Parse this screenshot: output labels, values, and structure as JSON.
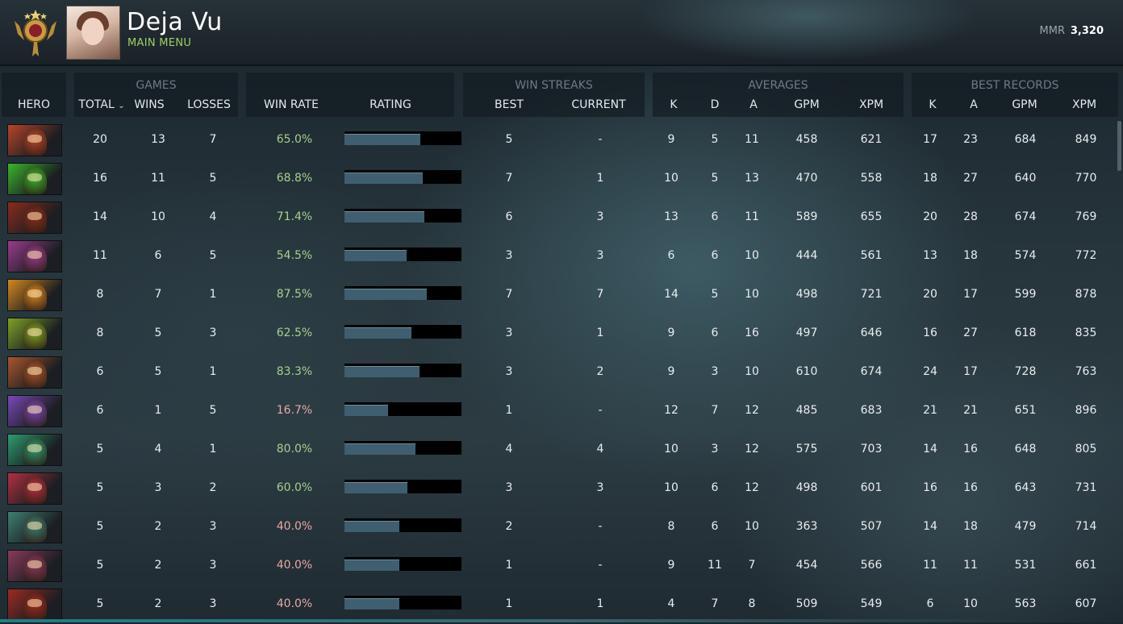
{
  "header": {
    "player_name": "Deja Vu",
    "subtitle": "MAIN MENU",
    "mmr_label": "MMR",
    "mmr_value": "3,320",
    "medal_icon": "immortal-rank-medal",
    "avatar_icon": "player-avatar"
  },
  "groups": {
    "games": "GAMES",
    "win_streaks": "WIN STREAKS",
    "averages": "AVERAGES",
    "best_records": "BEST RECORDS"
  },
  "columns": {
    "hero": "HERO",
    "total": "TOTAL",
    "wins": "WINS",
    "losses": "LOSSES",
    "win_rate": "WIN RATE",
    "rating": "RATING",
    "best": "BEST",
    "current": "CURRENT",
    "avg_k": "K",
    "avg_d": "D",
    "avg_a": "A",
    "avg_gpm": "GPM",
    "avg_xpm": "XPM",
    "best_k": "K",
    "best_a": "A",
    "best_gpm": "GPM",
    "best_xpm": "XPM"
  },
  "colors": {
    "win_rate_good": "#a6d08e",
    "win_rate_bad": "#e8a7a5",
    "rating_fill": "#3f5f70"
  },
  "rows": [
    {
      "hero_icon": "hero-portrait-1",
      "hero_color": "#b8452a",
      "total": "20",
      "wins": "13",
      "losses": "7",
      "win_rate": "65.0%",
      "rating": 0.65,
      "best": "5",
      "current": "-",
      "k": "9",
      "d": "5",
      "a": "11",
      "gpm": "458",
      "xpm": "621",
      "bk": "17",
      "ba": "23",
      "bgpm": "684",
      "bxpm": "849"
    },
    {
      "hero_icon": "hero-portrait-2",
      "hero_color": "#3bb52c",
      "total": "16",
      "wins": "11",
      "losses": "5",
      "win_rate": "68.8%",
      "rating": 0.67,
      "best": "7",
      "current": "1",
      "k": "10",
      "d": "5",
      "a": "13",
      "gpm": "470",
      "xpm": "558",
      "bk": "18",
      "ba": "27",
      "bgpm": "640",
      "bxpm": "770"
    },
    {
      "hero_icon": "hero-portrait-3",
      "hero_color": "#8a2c1d",
      "total": "14",
      "wins": "10",
      "losses": "4",
      "win_rate": "71.4%",
      "rating": 0.68,
      "best": "6",
      "current": "3",
      "k": "13",
      "d": "6",
      "a": "11",
      "gpm": "589",
      "xpm": "655",
      "bk": "20",
      "ba": "28",
      "bgpm": "674",
      "bxpm": "769"
    },
    {
      "hero_icon": "hero-portrait-4",
      "hero_color": "#9a3c8e",
      "total": "11",
      "wins": "6",
      "losses": "5",
      "win_rate": "54.5%",
      "rating": 0.53,
      "best": "3",
      "current": "3",
      "k": "6",
      "d": "6",
      "a": "10",
      "gpm": "444",
      "xpm": "561",
      "bk": "13",
      "ba": "18",
      "bgpm": "574",
      "bxpm": "772"
    },
    {
      "hero_icon": "hero-portrait-5",
      "hero_color": "#d6871f",
      "total": "8",
      "wins": "7",
      "losses": "1",
      "win_rate": "87.5%",
      "rating": 0.7,
      "best": "7",
      "current": "7",
      "k": "14",
      "d": "5",
      "a": "10",
      "gpm": "498",
      "xpm": "721",
      "bk": "20",
      "ba": "17",
      "bgpm": "599",
      "bxpm": "878"
    },
    {
      "hero_icon": "hero-portrait-6",
      "hero_color": "#7fa325",
      "total": "8",
      "wins": "5",
      "losses": "3",
      "win_rate": "62.5%",
      "rating": 0.57,
      "best": "3",
      "current": "1",
      "k": "9",
      "d": "6",
      "a": "16",
      "gpm": "497",
      "xpm": "646",
      "bk": "16",
      "ba": "27",
      "bgpm": "618",
      "bxpm": "835"
    },
    {
      "hero_icon": "hero-portrait-7",
      "hero_color": "#a8562d",
      "total": "6",
      "wins": "5",
      "losses": "1",
      "win_rate": "83.3%",
      "rating": 0.64,
      "best": "3",
      "current": "2",
      "k": "9",
      "d": "3",
      "a": "10",
      "gpm": "610",
      "xpm": "674",
      "bk": "24",
      "ba": "17",
      "bgpm": "728",
      "bxpm": "763"
    },
    {
      "hero_icon": "hero-portrait-8",
      "hero_color": "#7a49b8",
      "total": "6",
      "wins": "1",
      "losses": "5",
      "win_rate": "16.7%",
      "rating": 0.37,
      "best": "1",
      "current": "-",
      "k": "12",
      "d": "7",
      "a": "12",
      "gpm": "485",
      "xpm": "683",
      "bk": "21",
      "ba": "21",
      "bgpm": "651",
      "bxpm": "896"
    },
    {
      "hero_icon": "hero-portrait-9",
      "hero_color": "#2e9c6f",
      "total": "5",
      "wins": "4",
      "losses": "1",
      "win_rate": "80.0%",
      "rating": 0.61,
      "best": "4",
      "current": "4",
      "k": "10",
      "d": "3",
      "a": "12",
      "gpm": "575",
      "xpm": "703",
      "bk": "14",
      "ba": "16",
      "bgpm": "648",
      "bxpm": "805"
    },
    {
      "hero_icon": "hero-portrait-10",
      "hero_color": "#b33040",
      "total": "5",
      "wins": "3",
      "losses": "2",
      "win_rate": "60.0%",
      "rating": 0.54,
      "best": "3",
      "current": "3",
      "k": "10",
      "d": "6",
      "a": "12",
      "gpm": "498",
      "xpm": "601",
      "bk": "16",
      "ba": "16",
      "bgpm": "643",
      "bxpm": "731"
    },
    {
      "hero_icon": "hero-portrait-11",
      "hero_color": "#3f7f72",
      "total": "5",
      "wins": "2",
      "losses": "3",
      "win_rate": "40.0%",
      "rating": 0.47,
      "best": "2",
      "current": "-",
      "k": "8",
      "d": "6",
      "a": "10",
      "gpm": "363",
      "xpm": "507",
      "bk": "14",
      "ba": "18",
      "bgpm": "479",
      "bxpm": "714"
    },
    {
      "hero_icon": "hero-portrait-12",
      "hero_color": "#8a3a5c",
      "total": "5",
      "wins": "2",
      "losses": "3",
      "win_rate": "40.0%",
      "rating": 0.47,
      "best": "1",
      "current": "-",
      "k": "9",
      "d": "11",
      "a": "7",
      "gpm": "454",
      "xpm": "566",
      "bk": "11",
      "ba": "11",
      "bgpm": "531",
      "bxpm": "661"
    },
    {
      "hero_icon": "hero-portrait-13",
      "hero_color": "#9e2a22",
      "total": "5",
      "wins": "2",
      "losses": "3",
      "win_rate": "40.0%",
      "rating": 0.47,
      "best": "1",
      "current": "1",
      "k": "4",
      "d": "7",
      "a": "8",
      "gpm": "509",
      "xpm": "549",
      "bk": "6",
      "ba": "10",
      "bgpm": "563",
      "bxpm": "607"
    }
  ]
}
